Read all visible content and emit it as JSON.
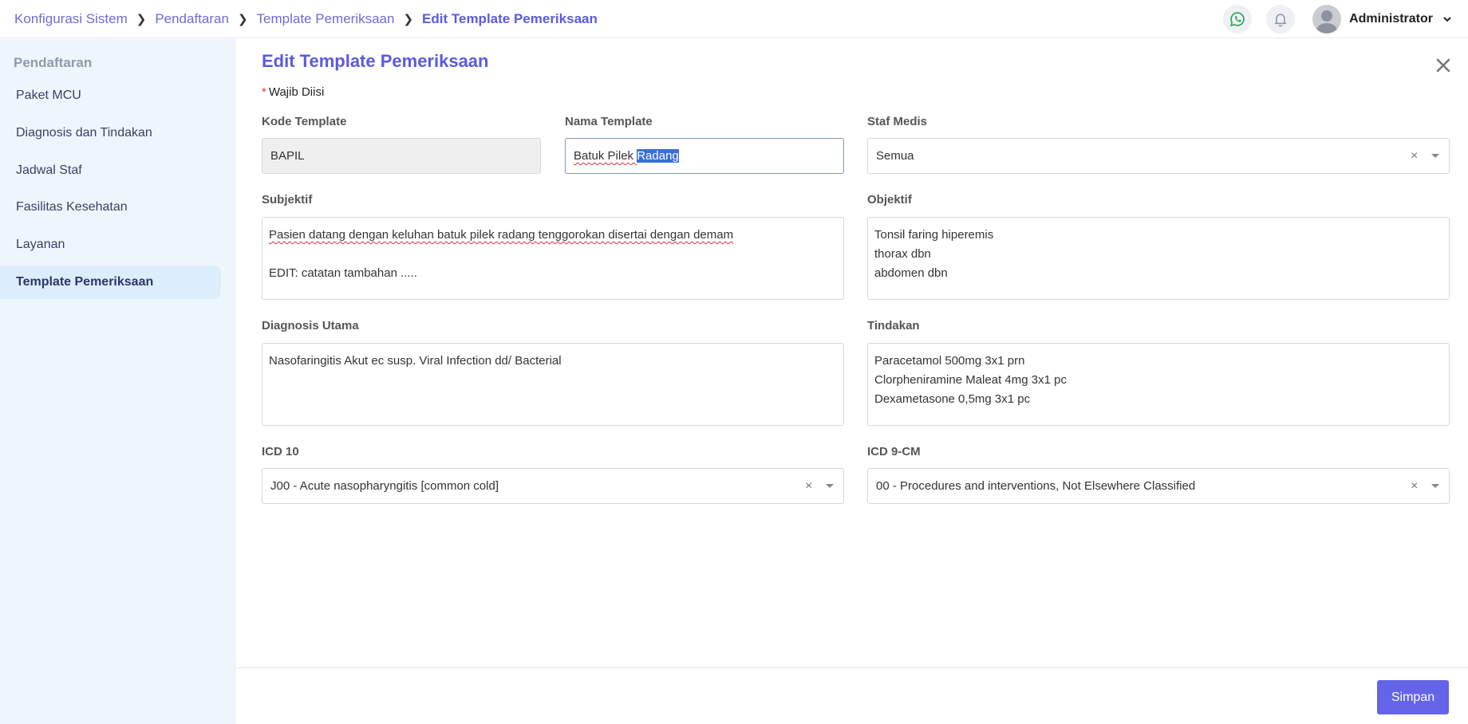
{
  "breadcrumb": {
    "items": [
      "Konfigurasi Sistem",
      "Pendaftaran",
      "Template Pemeriksaan"
    ],
    "current": "Edit Template Pemeriksaan"
  },
  "header": {
    "user_name": "Administrator",
    "whatsapp_color": "#2ea44f"
  },
  "sidebar": {
    "title": "Pendaftaran",
    "items": [
      {
        "label": "Paket MCU"
      },
      {
        "label": "Diagnosis dan Tindakan"
      },
      {
        "label": "Jadwal Staf"
      },
      {
        "label": "Fasilitas Kesehatan"
      },
      {
        "label": "Layanan"
      },
      {
        "label": "Template Pemeriksaan",
        "active": true
      }
    ]
  },
  "form": {
    "title": "Edit Template Pemeriksaan",
    "required_star": "*",
    "required_note": "Wajib Diisi",
    "kode_template": {
      "label": "Kode Template",
      "value": "BAPIL"
    },
    "nama_template": {
      "label": "Nama Template",
      "value_plain": "Batuk Pilek ",
      "value_selected": "Radang"
    },
    "staf_medis": {
      "label": "Staf Medis",
      "value": "Semua"
    },
    "subjektif": {
      "label": "Subjektif",
      "lines": [
        "Pasien datang dengan keluhan batuk pilek radang tenggorokan disertai dengan demam",
        "",
        "EDIT: catatan tambahan ....."
      ]
    },
    "objektif": {
      "label": "Objektif",
      "lines": [
        "Tonsil faring hiperemis",
        "thorax dbn",
        "abdomen dbn"
      ]
    },
    "diagnosis_utama": {
      "label": "Diagnosis Utama",
      "lines": [
        "Nasofaringitis Akut ec susp. Viral Infection dd/ Bacterial"
      ]
    },
    "tindakan": {
      "label": "Tindakan",
      "lines": [
        "Paracetamol 500mg 3x1 prn",
        "Clorpheniramine Maleat 4mg 3x1 pc",
        "Dexametasone 0,5mg 3x1 pc"
      ]
    },
    "icd10": {
      "label": "ICD 10",
      "value": "J00 - Acute nasopharyngitis [common cold]"
    },
    "icd9": {
      "label": "ICD 9-CM",
      "value": "00 - Procedures and interventions, Not Elsewhere Classified"
    },
    "clear_symbol": "×"
  },
  "footer": {
    "save_label": "Simpan"
  },
  "colors": {
    "accent": "#5a5ae0",
    "button": "#6464e8",
    "selection": "#3a6fd8"
  }
}
